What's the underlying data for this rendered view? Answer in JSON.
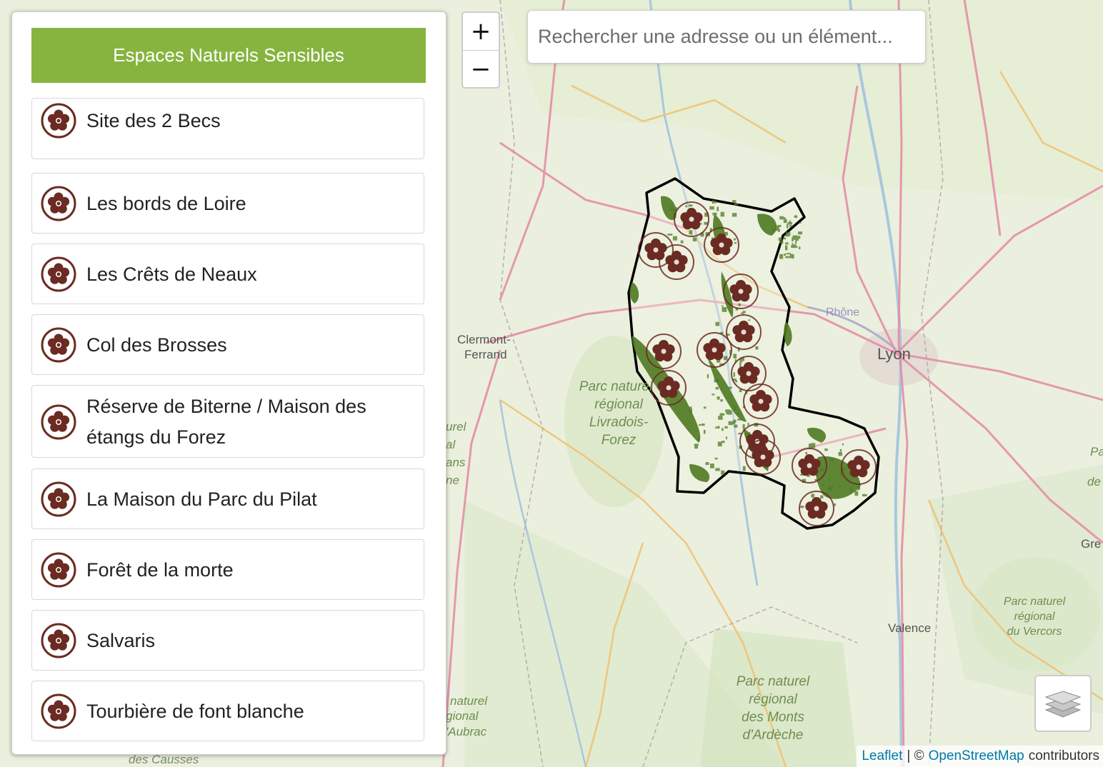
{
  "panel": {
    "title": "Espaces Naturels Sensibles",
    "sites": [
      {
        "label": "Site des 2 Becs"
      },
      {
        "label": "Les bords de Loire"
      },
      {
        "label": "Les Crêts de Neaux"
      },
      {
        "label": "Col des Brosses"
      },
      {
        "label": "Réserve de Biterne / Maison des étangs du Forez"
      },
      {
        "label": "La Maison du Parc du Pilat"
      },
      {
        "label": "Forêt de la morte"
      },
      {
        "label": "Salvaris"
      },
      {
        "label": "Tourbière de font blanche"
      }
    ]
  },
  "zoom": {
    "in_label": "+",
    "out_label": "−"
  },
  "search": {
    "placeholder": "Rechercher une adresse ou un élément..."
  },
  "attribution": {
    "leaflet": "Leaflet",
    "separator": "| ©",
    "osm": "OpenStreetMap",
    "suffix": "contributors"
  },
  "map_labels": {
    "clermont": "Clermont-",
    "ferrand": "Ferrand",
    "lyon": "Lyon",
    "rhone": "Rhône",
    "valence": "Valence",
    "gre": "Gre",
    "livradois": [
      "Parc naturel",
      "régional",
      "Livradois-",
      "Forez"
    ],
    "vercors": [
      "Parc naturel",
      "régional",
      "du Vercors"
    ],
    "ardeche": [
      "Parc naturel",
      "régional",
      "des Monts",
      "d'Ardèche"
    ],
    "aubrac": [
      "naturel",
      "gional",
      "'Aubrac"
    ],
    "causses": "des Causses",
    "left_park": [
      "urel",
      "al",
      "ans",
      "ne"
    ],
    "right_park": [
      "Pa",
      "de"
    ]
  },
  "colors": {
    "header_bg": "#86b43e",
    "marker": "#6b2b22",
    "green_zone": "#4f7a22",
    "boundary": "#000000"
  },
  "icons": {
    "site": "flower-marker-icon",
    "layers": "layers-icon"
  }
}
